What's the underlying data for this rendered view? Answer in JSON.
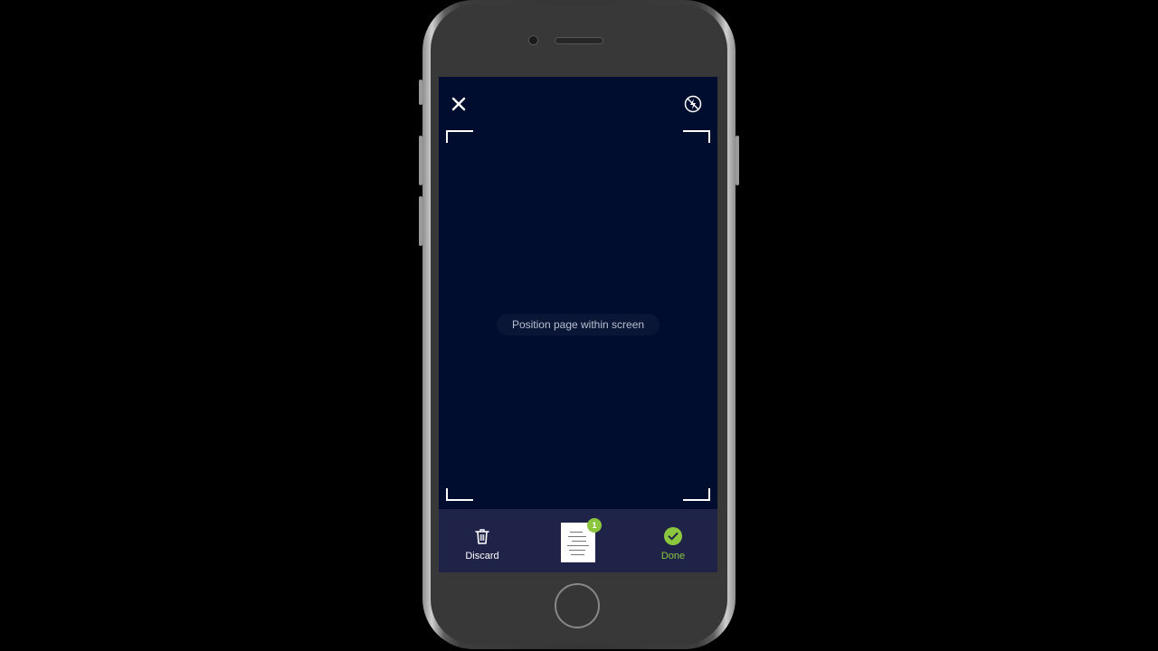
{
  "colors": {
    "screen_bg": "#010d2e",
    "bottom_bar_bg": "#1f2347",
    "accent_green": "#8cc63f",
    "hint_text": "#b8bfd0"
  },
  "top_bar": {
    "close_icon": "close-icon",
    "flash_icon": "flash-off-icon"
  },
  "viewfinder": {
    "hint": "Position page within screen"
  },
  "bottom_bar": {
    "discard_label": "Discard",
    "discard_icon": "trash-icon",
    "done_label": "Done",
    "done_icon": "check-circle-icon",
    "page_count": "1"
  }
}
